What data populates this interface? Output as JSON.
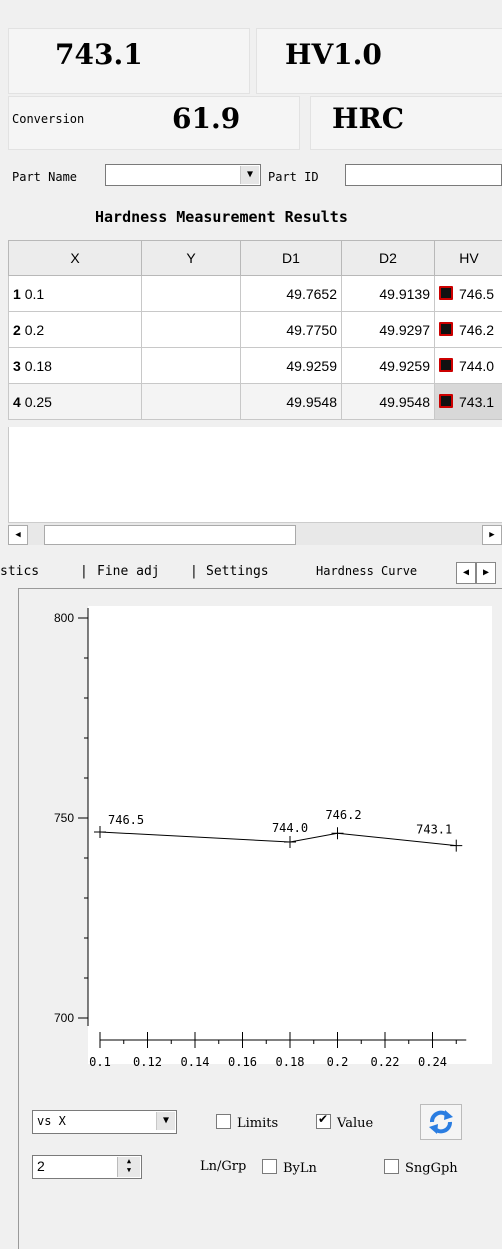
{
  "readout": {
    "hardness_value": "743.1",
    "scale": "HV1.0",
    "conversion_label": "Conversion",
    "conversion_value": "61.9",
    "conversion_scale": "HRC"
  },
  "ids": {
    "part_name_label": "Part Name",
    "part_name_value": "",
    "part_id_label": "Part ID",
    "part_id_value": ""
  },
  "results": {
    "title": "Hardness Measurement Results",
    "columns": [
      "X",
      "Y",
      "D1",
      "D2",
      "HV"
    ],
    "rows": [
      {
        "n": "1",
        "x": "0.1",
        "y": "",
        "d1": "49.7652",
        "d2": "49.9139",
        "hv": "746.5"
      },
      {
        "n": "2",
        "x": "0.2",
        "y": "",
        "d1": "49.7750",
        "d2": "49.9297",
        "hv": "746.2"
      },
      {
        "n": "3",
        "x": "0.18",
        "y": "",
        "d1": "49.9259",
        "d2": "49.9259",
        "hv": "744.0"
      },
      {
        "n": "4",
        "x": "0.25",
        "y": "",
        "d1": "49.9548",
        "d2": "49.9548",
        "hv": "743.1"
      }
    ]
  },
  "tabs": [
    "stics",
    "Fine adj",
    "Settings",
    "Hardness Curve"
  ],
  "chart_data": {
    "type": "line",
    "x": [
      0.1,
      0.18,
      0.2,
      0.25
    ],
    "values": [
      746.5,
      744.0,
      746.2,
      743.1
    ],
    "labels": [
      "746.5",
      "744.0",
      "746.2",
      "743.1"
    ],
    "xticks": [
      "0.1",
      "0.12",
      "0.14",
      "0.16",
      "0.18",
      "0.2",
      "0.22",
      "0.24"
    ],
    "xlim": [
      0.1,
      0.26
    ],
    "ylim": [
      700,
      800
    ],
    "yticks": [
      "800",
      "750",
      "700"
    ],
    "colors": {
      "line": "#000000",
      "background": "#ffffff"
    }
  },
  "controls": {
    "mode_select": "vs X",
    "limits_label": "Limits",
    "limits_checked": false,
    "value_label": "Value",
    "value_checked": true,
    "spin_value": "2",
    "lngrp_label": "Ln/Grp",
    "byln_label": "ByLn",
    "sngph_label": "SngGph"
  }
}
